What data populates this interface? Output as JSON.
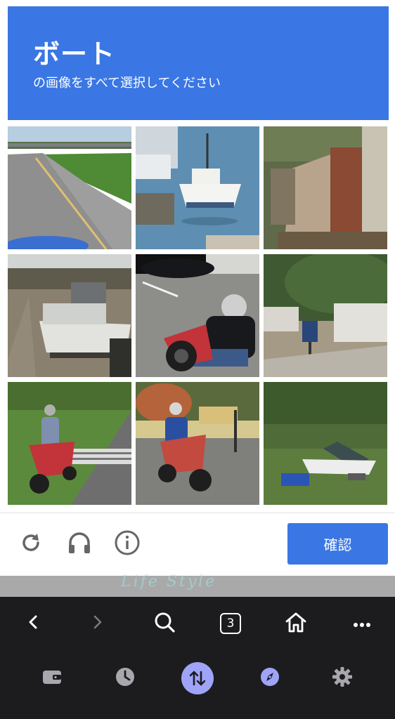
{
  "captcha": {
    "title": "ボート",
    "subtitle": "の画像をすべて選択してください",
    "accent_color": "#3a77e4",
    "tiles": [
      {
        "name": "tile-road-highway",
        "scene": "road"
      },
      {
        "name": "tile-sailboat-harbor",
        "scene": "sailboat"
      },
      {
        "name": "tile-shack-wall",
        "scene": "shack"
      },
      {
        "name": "tile-boat-on-trailer",
        "scene": "trailerboat"
      },
      {
        "name": "tile-motorcycle-rider",
        "scene": "motorcycle"
      },
      {
        "name": "tile-house-signboard",
        "scene": "house"
      },
      {
        "name": "tile-scooter-path",
        "scene": "scooter-path"
      },
      {
        "name": "tile-scooter-bench",
        "scene": "scooter-bench"
      },
      {
        "name": "tile-covered-boat",
        "scene": "coveredboat"
      }
    ],
    "footer": {
      "reload_icon": "reload-icon",
      "audio_icon": "headphones-icon",
      "info_icon": "info-icon",
      "verify_label": "確認"
    }
  },
  "background_text": "Life Style",
  "browser": {
    "nav": [
      "back-icon",
      "forward-icon",
      "search-icon",
      "tabs-icon",
      "home-icon",
      "more-icon"
    ],
    "tab_count": "3",
    "toolbar": [
      "wallet-icon",
      "history-icon",
      "transfer-icon",
      "explore-icon",
      "settings-icon"
    ],
    "active_color": "#9fa4f9"
  }
}
